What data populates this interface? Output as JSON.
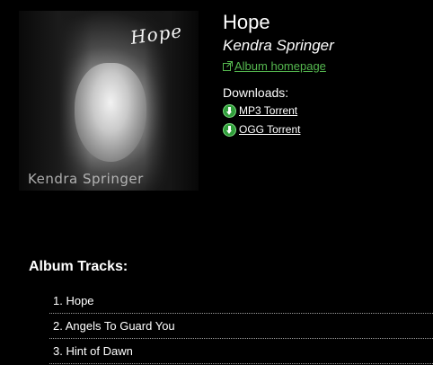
{
  "album": {
    "title": "Hope",
    "artist": "Kendra Springer",
    "homepage_link": "Album homepage",
    "cover": {
      "script_text": "Hope",
      "artist_text": "Kendra Springer"
    }
  },
  "downloads": {
    "label": "Downloads:",
    "items": [
      {
        "label": "MP3 Torrent",
        "icon": "download-arrow-icon"
      },
      {
        "label": "OGG Torrent",
        "icon": "download-arrow-icon"
      }
    ]
  },
  "tracks": {
    "heading": "Album Tracks:",
    "items": [
      {
        "label": "1. Hope"
      },
      {
        "label": "2. Angels To Guard You"
      },
      {
        "label": "3. Hint of Dawn"
      }
    ]
  },
  "colors": {
    "background": "#000000",
    "text": "#ffffff",
    "link": "#55b84f",
    "download_icon": "#2f9e3a"
  }
}
